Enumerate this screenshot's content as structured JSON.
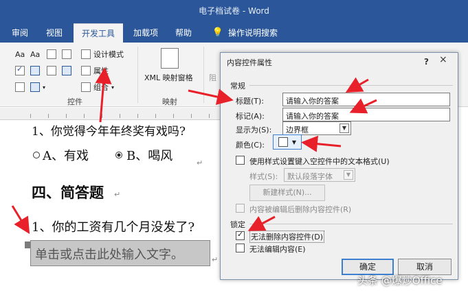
{
  "window": {
    "title": "电子档试卷 - Word"
  },
  "tabs": [
    {
      "label": "审阅"
    },
    {
      "label": "视图"
    },
    {
      "label": "开发工具"
    },
    {
      "label": "加载项"
    },
    {
      "label": "帮助"
    },
    {
      "label": "操作说明搜索"
    }
  ],
  "ribbon": {
    "controls_group": "控件",
    "mapping_group": "映射",
    "design_mode": "设计模式",
    "properties": "属性",
    "group": "组合",
    "xml_pane": "XML 映射窗格",
    "aa1": "Aa",
    "aa2": "Aa",
    "truncated": "阻"
  },
  "document": {
    "q_line": "1、你觉得今年年终奖有戏吗?",
    "option_a": "A、有戏",
    "option_b": "B、喝风",
    "section": "四、简答题",
    "question": "1、你的工资有几个月没发了?",
    "placeholder": "单击或点击此处输入文字。"
  },
  "dialog": {
    "title": "内容控件属性",
    "help": "?",
    "close": "×",
    "general": "常规",
    "title_label": "标题(T):",
    "title_value": "请输入你的答案",
    "tag_label": "标记(A):",
    "tag_value": "请输入你的答案",
    "show_as_label": "显示为(S):",
    "show_as_value": "边界框",
    "color_label": "颜色(C):",
    "use_style_label": "使用样式设置键入空控件中的文本格式(U)",
    "style_label": "样式(S):",
    "style_value": "默认段落字体",
    "new_style": "新建样式(N)...",
    "remove_label": "内容被编辑后删除内容控件(R)",
    "lock_label": "锁定",
    "no_delete_label": "无法删除内容控件(D)",
    "no_edit_label": "无法编辑内容(E)",
    "ok": "确定",
    "cancel": "取消"
  },
  "watermark": "头条 @爆炒Office",
  "colors": {
    "word_blue": "#2b579a",
    "arrow_red": "#e8202a"
  }
}
